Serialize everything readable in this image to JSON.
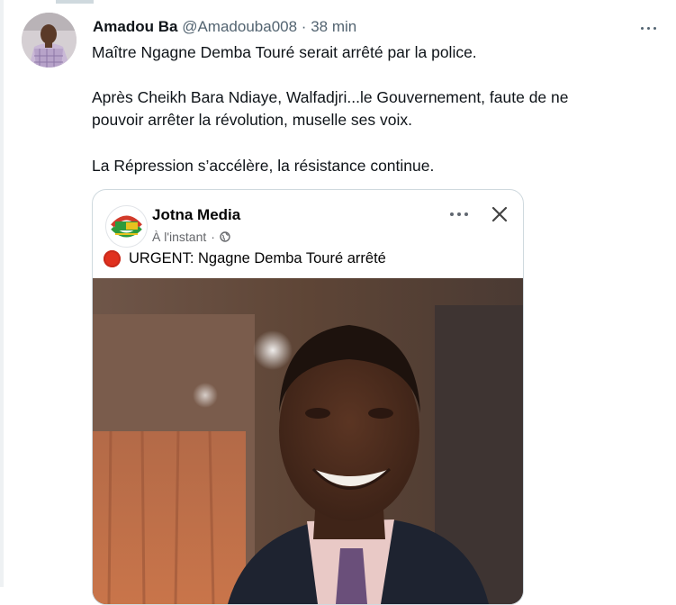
{
  "tweet": {
    "author_name": "Amadou Ba",
    "author_handle": "@Amadouba008",
    "separator": "·",
    "time": "38 min",
    "avatar_icon": "user-avatar",
    "more_icon": "more-horizontal-icon",
    "text": {
      "line1": "Maître Ngagne Demba Touré serait arrêté par la police.",
      "line2": "Après Cheikh Bara Ndiaye, Walfadjri...le Gouvernement, faute de ne",
      "line3": "pouvoir arrêter la révolution, muselle ses voix.",
      "line4": "La Répression s’accélère, la résistance continue."
    }
  },
  "embedded_post": {
    "page_name": "Jotna Media",
    "timestamp": "À l'instant",
    "separator": "·",
    "globe_icon": "globe-icon",
    "more_icon": "more-horizontal-icon",
    "close_icon": "close-icon",
    "headline_icon": "stop-sign-emoji",
    "headline": "URGENT: Ngagne Demba Touré arrêté",
    "logo_icon": "jotna-media-logo",
    "photo": "portrait-photo"
  },
  "colors": {
    "text_primary": "#0f1419",
    "text_secondary": "#536471",
    "border": "#cfd9de",
    "urgent_red": "#e0301e"
  }
}
